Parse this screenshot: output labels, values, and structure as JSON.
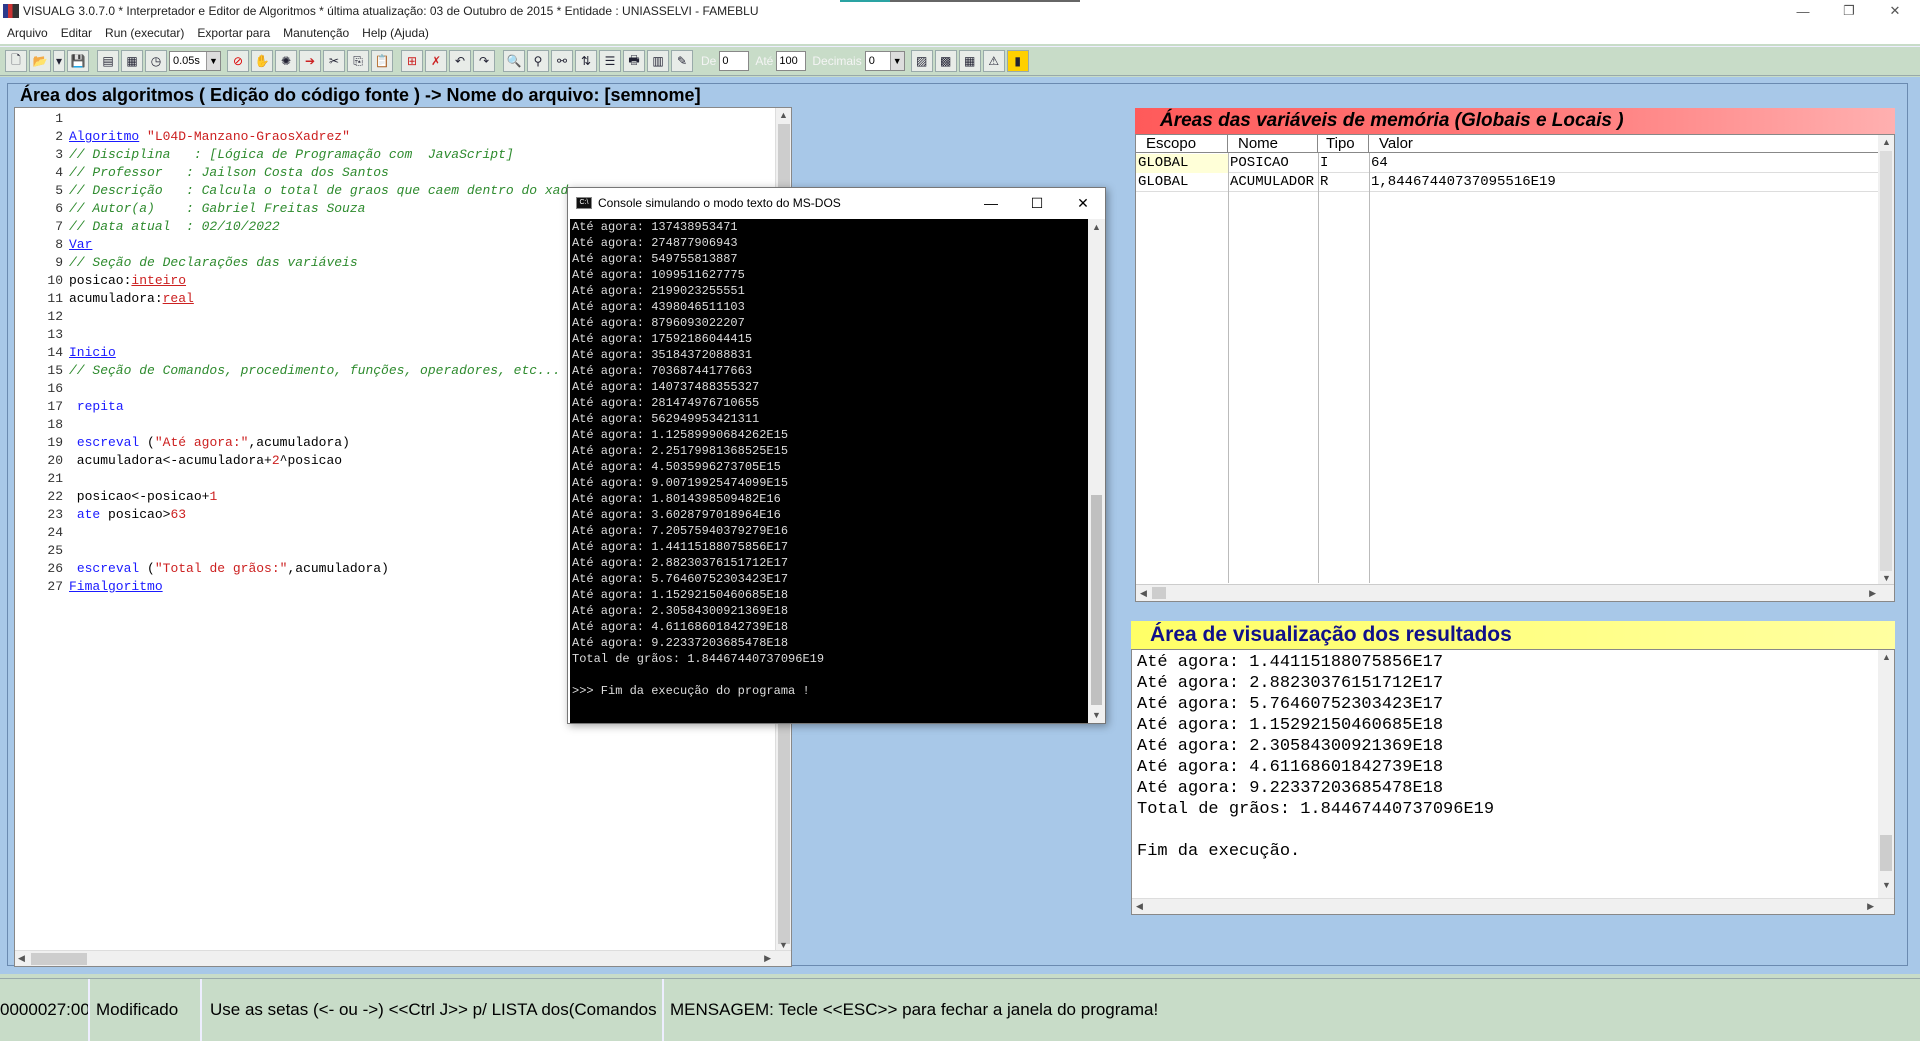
{
  "window": {
    "title": "VISUALG 3.0.7.0 * Interpretador e Editor de Algoritmos * última atualização: 03 de Outubro de 2015 * Entidade : UNIASSELVI - FAMEBLU",
    "controls": {
      "minimize": "—",
      "restore": "❐",
      "close": "✕"
    }
  },
  "menu": [
    "Arquivo",
    "Editar",
    "Run (executar)",
    "Exportar para",
    "Manutenção",
    "Help (Ajuda)"
  ],
  "toolbar": {
    "speed": "0.05s",
    "de_label": "De",
    "de_value": "0",
    "ate_label": "Até",
    "ate_value": "100",
    "decimais_label": "Decimais",
    "decimais_value": "0"
  },
  "editor": {
    "title": "Área dos algoritmos ( Edição do código fonte ) -> Nome do arquivo: [semnome]",
    "lines": [
      [],
      [
        [
          "kw",
          "Algoritmo"
        ],
        [
          "p",
          " "
        ],
        [
          "str",
          "\"L04D-Manzano-GraosXadrez\""
        ]
      ],
      [
        [
          "cm",
          "// Disciplina   : [Lógica de Programação com  JavaScript]"
        ]
      ],
      [
        [
          "cm",
          "// Professor   : Jailson Costa dos Santos"
        ]
      ],
      [
        [
          "cm",
          "// Descrição   : Calcula o total de graos que caem dentro do xadrez"
        ]
      ],
      [
        [
          "cm",
          "// Autor(a)    : Gabriel Freitas Souza"
        ]
      ],
      [
        [
          "cm",
          "// Data atual  : 02/10/2022"
        ]
      ],
      [
        [
          "kw",
          "Var"
        ]
      ],
      [
        [
          "cm",
          "// Seção de Declarações das variáveis"
        ]
      ],
      [
        [
          "p",
          "posicao:"
        ],
        [
          "type",
          "inteiro"
        ]
      ],
      [
        [
          "p",
          "acumuladora:"
        ],
        [
          "type",
          "real"
        ]
      ],
      [],
      [],
      [
        [
          "kw",
          "Inicio"
        ]
      ],
      [
        [
          "cm",
          "// Seção de Comandos, procedimento, funções, operadores, etc..."
        ]
      ],
      [],
      [
        [
          "p",
          " "
        ],
        [
          "kw2",
          "repita"
        ]
      ],
      [],
      [
        [
          "p",
          " "
        ],
        [
          "kw2",
          "escreval"
        ],
        [
          "p",
          " ("
        ],
        [
          "str",
          "\"Até agora:\""
        ],
        [
          "p",
          ",acumuladora)"
        ]
      ],
      [
        [
          "p",
          " acumuladora<-acumuladora+"
        ],
        [
          "num",
          "2"
        ],
        [
          "p",
          "^posicao"
        ]
      ],
      [],
      [
        [
          "p",
          " posicao<-posicao+"
        ],
        [
          "num",
          "1"
        ]
      ],
      [
        [
          "p",
          " "
        ],
        [
          "kw2",
          "ate"
        ],
        [
          "p",
          " posicao>"
        ],
        [
          "num",
          "63"
        ]
      ],
      [],
      [],
      [
        [
          "p",
          " "
        ],
        [
          "kw2",
          "escreval"
        ],
        [
          "p",
          " ("
        ],
        [
          "str",
          "\"Total de grãos:\""
        ],
        [
          "p",
          ",acumuladora)"
        ]
      ],
      [
        [
          "kw",
          "Fimalgoritmo"
        ]
      ]
    ]
  },
  "variables": {
    "title": "Áreas das variáveis de memória (Globais e Locais )",
    "headers": [
      "Escopo",
      "Nome",
      "Tipo",
      "Valor"
    ],
    "rows": [
      [
        "GLOBAL",
        "POSICAO",
        "I",
        "64"
      ],
      [
        "GLOBAL",
        "ACUMULADOR",
        "R",
        "1,84467440737095516E19"
      ]
    ]
  },
  "results": {
    "title": "Área de visualização dos resultados",
    "lines": [
      "Até agora: 1.44115188075856E17",
      "Até agora: 2.88230376151712E17",
      "Até agora: 5.76460752303423E17",
      "Até agora: 1.15292150460685E18",
      "Até agora: 2.30584300921369E18",
      "Até agora: 4.61168601842739E18",
      "Até agora: 9.22337203685478E18",
      "Total de grãos: 1.84467440737096E19",
      "",
      "Fim da execução."
    ]
  },
  "console": {
    "title": "Console simulando o modo texto do MS-DOS",
    "lines": [
      "Até agora: 137438953471",
      "Até agora: 274877906943",
      "Até agora: 549755813887",
      "Até agora: 1099511627775",
      "Até agora: 2199023255551",
      "Até agora: 4398046511103",
      "Até agora: 8796093022207",
      "Até agora: 17592186044415",
      "Até agora: 35184372088831",
      "Até agora: 70368744177663",
      "Até agora: 140737488355327",
      "Até agora: 281474976710655",
      "Até agora: 562949953421311",
      "Até agora: 1.12589990684262E15",
      "Até agora: 2.25179981368525E15",
      "Até agora: 4.5035996273705E15",
      "Até agora: 9.00719925474099E15",
      "Até agora: 1.8014398509482E16",
      "Até agora: 3.6028797018964E16",
      "Até agora: 7.20575940379279E16",
      "Até agora: 1.44115188075856E17",
      "Até agora: 2.88230376151712E17",
      "Até agora: 5.76460752303423E17",
      "Até agora: 1.15292150460685E18",
      "Até agora: 2.30584300921369E18",
      "Até agora: 4.61168601842739E18",
      "Até agora: 9.22337203685478E18",
      "Total de grãos: 1.84467440737096E19",
      "",
      ">>> Fim da execução do programa !"
    ]
  },
  "status": {
    "position": "0000027:001",
    "state": "Modificado",
    "hint": "Use as setas (<- ou ->) <<Ctrl J>> p/ LISTA dos(Comandos",
    "message": "MENSAGEM: Tecle <<ESC>> para fechar a janela do programa!"
  }
}
